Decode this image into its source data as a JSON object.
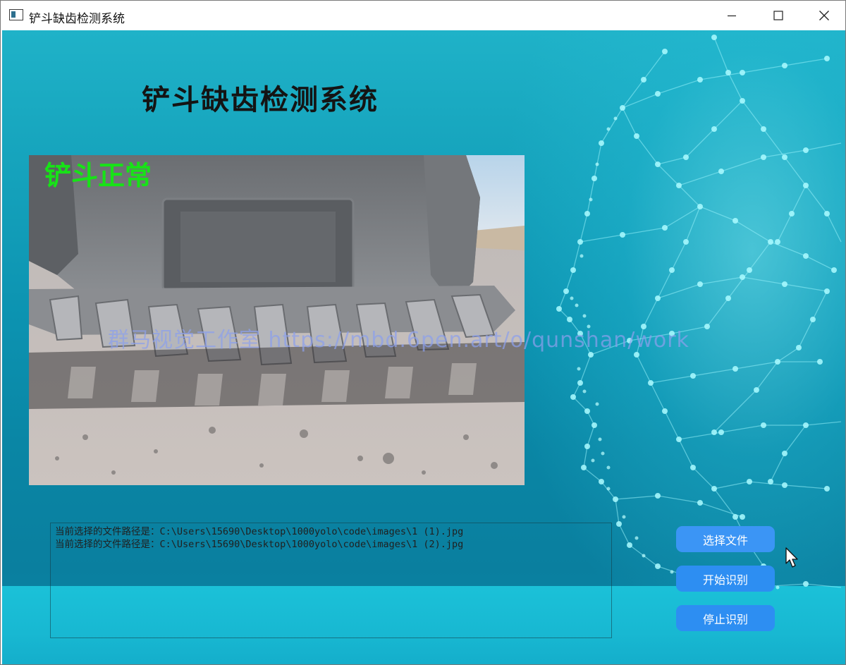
{
  "window": {
    "title": "铲斗缺齿检测系统"
  },
  "app": {
    "heading": "铲斗缺齿检测系统",
    "status_label": "铲斗正常",
    "watermark": "群马视觉工作室 https://mbd.6pen.art/o/qunshan/work"
  },
  "log": {
    "lines": [
      "当前选择的文件路径是：C:\\Users\\15690\\Desktop\\1000yolo\\code\\images\\1 (1).jpg",
      "当前选择的文件路径是：C:\\Users\\15690\\Desktop\\1000yolo\\code\\images\\1 (2).jpg"
    ]
  },
  "buttons": {
    "select_file": "选择文件",
    "start_detect": "开始识别",
    "stop_detect": "停止识别"
  },
  "icons": {
    "app": "app-window-icon",
    "minimize": "minimize-icon",
    "maximize": "maximize-icon",
    "close": "close-icon",
    "cursor": "mouse-pointer-icon"
  },
  "colors": {
    "accent_button": "#2d8ef2",
    "status_text": "#17e317",
    "background": "#0c93b1"
  }
}
